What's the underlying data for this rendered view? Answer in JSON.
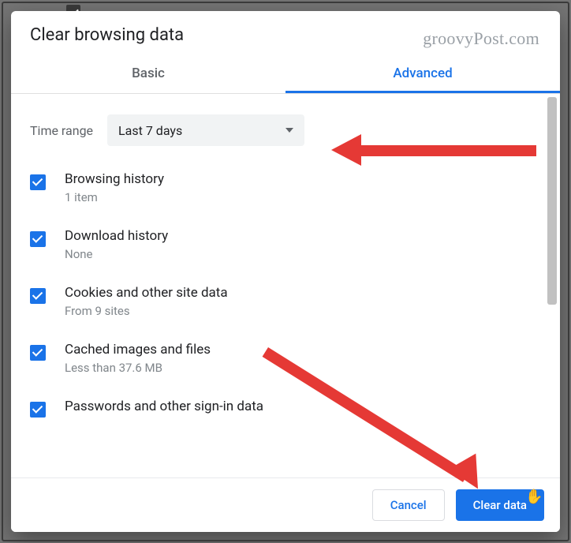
{
  "watermark": "groovyPost.com",
  "dialog": {
    "title": "Clear browsing data",
    "tabs": {
      "basic": "Basic",
      "advanced": "Advanced",
      "active": "advanced"
    },
    "timeRange": {
      "label": "Time range",
      "value": "Last 7 days"
    },
    "items": [
      {
        "title": "Browsing history",
        "sub": "1 item",
        "checked": true
      },
      {
        "title": "Download history",
        "sub": "None",
        "checked": true
      },
      {
        "title": "Cookies and other site data",
        "sub": "From 9 sites",
        "checked": true
      },
      {
        "title": "Cached images and files",
        "sub": "Less than 37.6 MB",
        "checked": true
      },
      {
        "title": "Passwords and other sign-in data",
        "sub": "",
        "checked": true
      }
    ],
    "buttons": {
      "cancel": "Cancel",
      "confirm": "Clear data"
    }
  }
}
